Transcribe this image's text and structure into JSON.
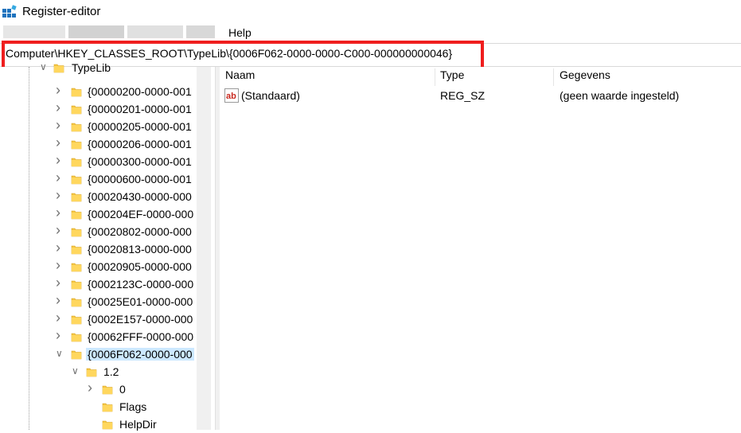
{
  "window": {
    "title": "Register-editor"
  },
  "menu": {
    "help_label": "Help"
  },
  "address": {
    "path": "Computer\\HKEY_CLASSES_ROOT\\TypeLib\\{0006F062-0000-0000-C000-000000000046}"
  },
  "tree": {
    "root": "TypeLib",
    "items": [
      "{00000200-0000-001",
      "{00000201-0000-001",
      "{00000205-0000-001",
      "{00000206-0000-001",
      "{00000300-0000-001",
      "{00000600-0000-001",
      "{00020430-0000-000",
      "{000204EF-0000-000",
      "{00020802-0000-000",
      "{00020813-0000-000",
      "{00020905-0000-000",
      "{0002123C-0000-000",
      "{00025E01-0000-000",
      "{0002E157-0000-000",
      "{00062FFF-0000-000",
      "{0006F062-0000-000"
    ],
    "version": "1.2",
    "sub_items": [
      "0",
      "Flags",
      "HelpDir"
    ]
  },
  "list": {
    "columns": [
      "Naam",
      "Type",
      "Gegevens"
    ],
    "rows": [
      {
        "name": "(Standaard)",
        "type": "REG_SZ",
        "data": "(geen waarde ingesteld)",
        "icon": "string-value-icon"
      }
    ]
  },
  "colors": {
    "highlight_border": "#ef1e1e",
    "selection": "#cce8ff",
    "folder": "#f4c542"
  }
}
